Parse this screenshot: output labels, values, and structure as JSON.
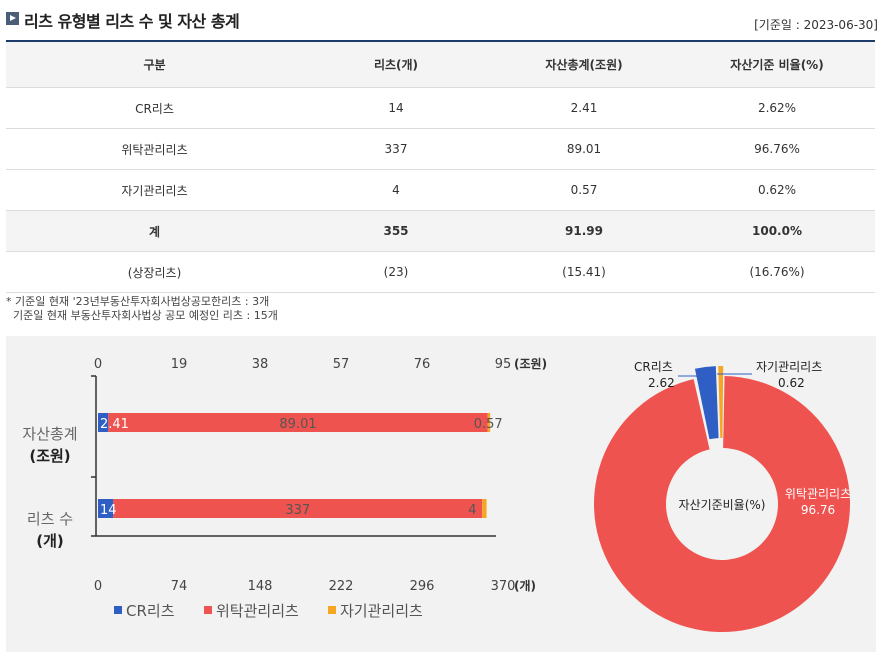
{
  "header": {
    "title": "리츠 유형별 리츠 수 및 자산 총계",
    "base_date": "[기준일 : 2023-06-30]"
  },
  "table": {
    "columns": [
      "구분",
      "리츠(개)",
      "자산총계(조원)",
      "자산기준 비율(%)"
    ],
    "rows": [
      [
        "CR리츠",
        "14",
        "2.41",
        "2.62%"
      ],
      [
        "위탁관리리츠",
        "337",
        "89.01",
        "96.76%"
      ],
      [
        "자기관리리츠",
        "4",
        "0.57",
        "0.62%"
      ]
    ],
    "total": [
      "계",
      "355",
      "91.99",
      "100.0%"
    ],
    "listed": [
      "(상장리츠)",
      "(23)",
      "(15.41)",
      "(16.76%)"
    ]
  },
  "notes": [
    "* 기준일 현재 '23년부동산투자회사법상공모한리츠 : 3개",
    "  기준일 현재 부동산투자회사법상 공모 예정인 리츠 : 15개"
  ],
  "colors": {
    "cr": "#2f5fc4",
    "trust": "#ef5350",
    "self": "#f5a623",
    "header_line": "#1e3a6b"
  },
  "chart_data": [
    {
      "type": "bar",
      "orientation": "horizontal",
      "stacked": true,
      "categories": [
        "자산총계 (조원)",
        "리츠 수 (개)"
      ],
      "category_lines": [
        [
          "자산총계",
          "(조원)"
        ],
        [
          "리츠 수",
          "(개)"
        ]
      ],
      "series": [
        {
          "name": "CR리츠",
          "values": [
            2.41,
            14
          ],
          "labels": [
            "2.41",
            "14"
          ]
        },
        {
          "name": "위탁관리리츠",
          "values": [
            89.01,
            337
          ],
          "labels": [
            "89.01",
            "337"
          ]
        },
        {
          "name": "자기관리리츠",
          "values": [
            0.57,
            4
          ],
          "labels": [
            "0.57",
            "4"
          ]
        }
      ],
      "top_axis": {
        "ticks": [
          "0",
          "19",
          "38",
          "57",
          "76",
          "95"
        ],
        "unit": "(조원)",
        "range": [
          0,
          95
        ]
      },
      "bottom_axis": {
        "ticks": [
          "0",
          "74",
          "148",
          "222",
          "296",
          "370"
        ],
        "unit": "(개)",
        "range": [
          0,
          370
        ]
      },
      "legend": [
        "CR리츠",
        "위탁관리리츠",
        "자기관리리츠"
      ],
      "legend_position": "bottom"
    },
    {
      "type": "pie",
      "donut": true,
      "center_label": "자산기준비율(%)",
      "slices": [
        {
          "name": "CR리츠",
          "value": 2.62,
          "label": "2.62"
        },
        {
          "name": "위탁관리리츠",
          "value": 96.76,
          "label": "96.76"
        },
        {
          "name": "자기관리리츠",
          "value": 0.62,
          "label": "0.62"
        }
      ]
    }
  ]
}
